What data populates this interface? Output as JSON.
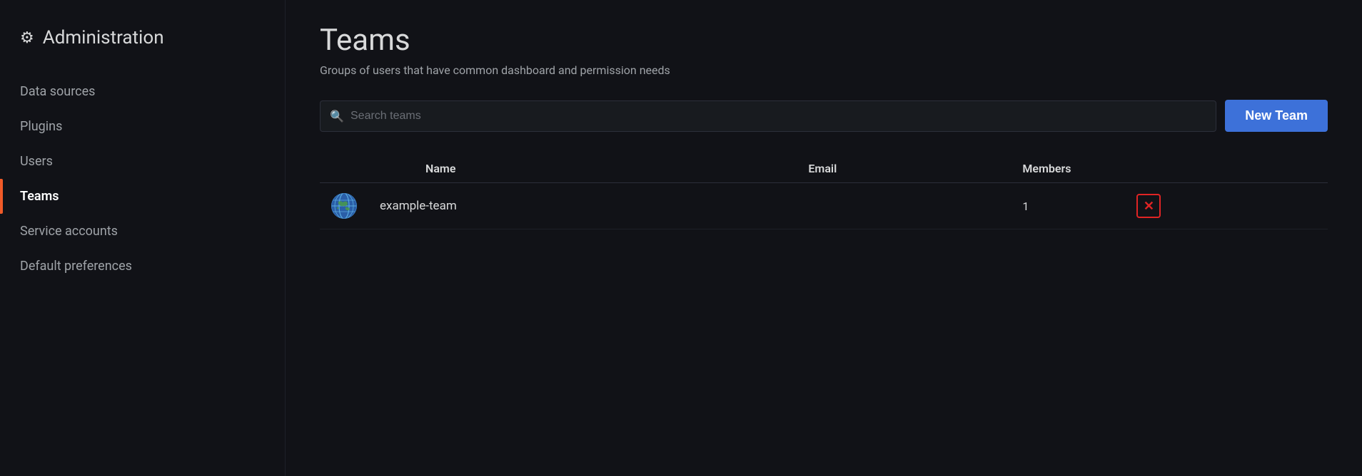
{
  "sidebar": {
    "header": {
      "title": "Administration",
      "icon": "⚙"
    },
    "items": [
      {
        "id": "data-sources",
        "label": "Data sources",
        "active": false
      },
      {
        "id": "plugins",
        "label": "Plugins",
        "active": false
      },
      {
        "id": "users",
        "label": "Users",
        "active": false
      },
      {
        "id": "teams",
        "label": "Teams",
        "active": true
      },
      {
        "id": "service-accounts",
        "label": "Service accounts",
        "active": false
      },
      {
        "id": "default-preferences",
        "label": "Default preferences",
        "active": false
      }
    ]
  },
  "main": {
    "title": "Teams",
    "subtitle": "Groups of users that have common dashboard and permission needs",
    "search": {
      "placeholder": "Search teams",
      "value": ""
    },
    "new_team_button": "New Team",
    "table": {
      "columns": [
        {
          "id": "name",
          "label": "Name"
        },
        {
          "id": "email",
          "label": "Email"
        },
        {
          "id": "members",
          "label": "Members"
        }
      ],
      "rows": [
        {
          "id": 1,
          "avatar": "globe",
          "name": "example-team",
          "email": "",
          "members": "1"
        }
      ]
    }
  }
}
